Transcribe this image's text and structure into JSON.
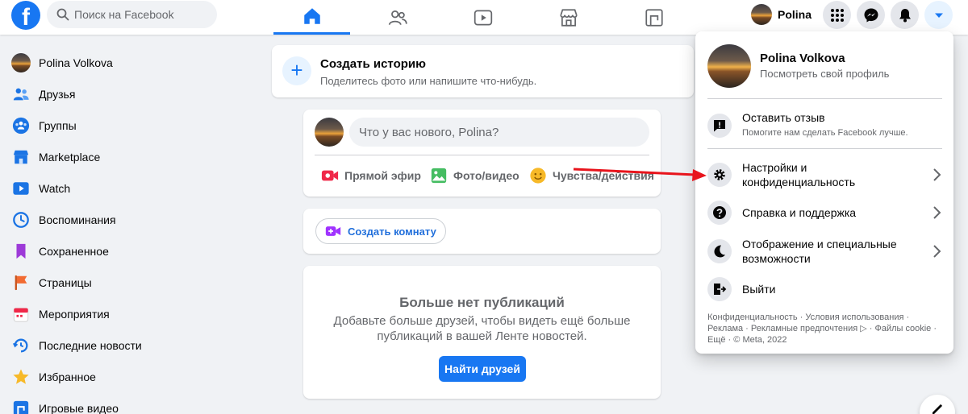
{
  "header": {
    "logo": "f",
    "search_placeholder": "Поиск на Facebook",
    "profile_name": "Polina"
  },
  "sidebar": {
    "items": [
      {
        "label": "Polina Volkova",
        "icon": "avatar"
      },
      {
        "label": "Друзья",
        "icon": "friends-icon"
      },
      {
        "label": "Группы",
        "icon": "groups-icon"
      },
      {
        "label": "Marketplace",
        "icon": "marketplace-icon"
      },
      {
        "label": "Watch",
        "icon": "watch-icon"
      },
      {
        "label": "Воспоминания",
        "icon": "memories-icon"
      },
      {
        "label": "Сохраненное",
        "icon": "saved-icon"
      },
      {
        "label": "Страницы",
        "icon": "pages-icon"
      },
      {
        "label": "Мероприятия",
        "icon": "events-icon"
      },
      {
        "label": "Последние новости",
        "icon": "recent-news-icon"
      },
      {
        "label": "Избранное",
        "icon": "favorites-icon"
      },
      {
        "label": "Игровые видео",
        "icon": "gaming-video-icon"
      }
    ]
  },
  "feed": {
    "story": {
      "plus": "+",
      "title": "Создать историю",
      "subtitle": "Поделитесь фото или напишите что-нибудь."
    },
    "composer": {
      "placeholder": "Что у вас нового, Polina?",
      "actions": [
        "Прямой эфир",
        "Фото/видео",
        "Чувства/действия"
      ]
    },
    "room_button": "Создать комнату",
    "no_more": {
      "title": "Больше нет публикаций",
      "text": "Добавьте больше друзей, чтобы видеть ещё больше публикаций в вашей Ленте новостей.",
      "button": "Найти друзей"
    }
  },
  "menu": {
    "profile_name": "Polina Volkova",
    "profile_link": "Посмотреть свой профиль",
    "feedback_title": "Оставить отзыв",
    "feedback_sub": "Помогите нам сделать Facebook лучше.",
    "settings": "Настройки и конфиденциальность",
    "help": "Справка и поддержка",
    "display": "Отображение и специальные возможности",
    "logout": "Выйти",
    "footer": "Конфиденциальность · Условия использования · Реклама · Рекламные предпочтения ▷ · Файлы cookie · Ещё · © Meta, 2022"
  },
  "colors": {
    "brand_blue": "#1877f2",
    "annotation_arrow": "#e8141c",
    "background": "#f0f2f5"
  }
}
